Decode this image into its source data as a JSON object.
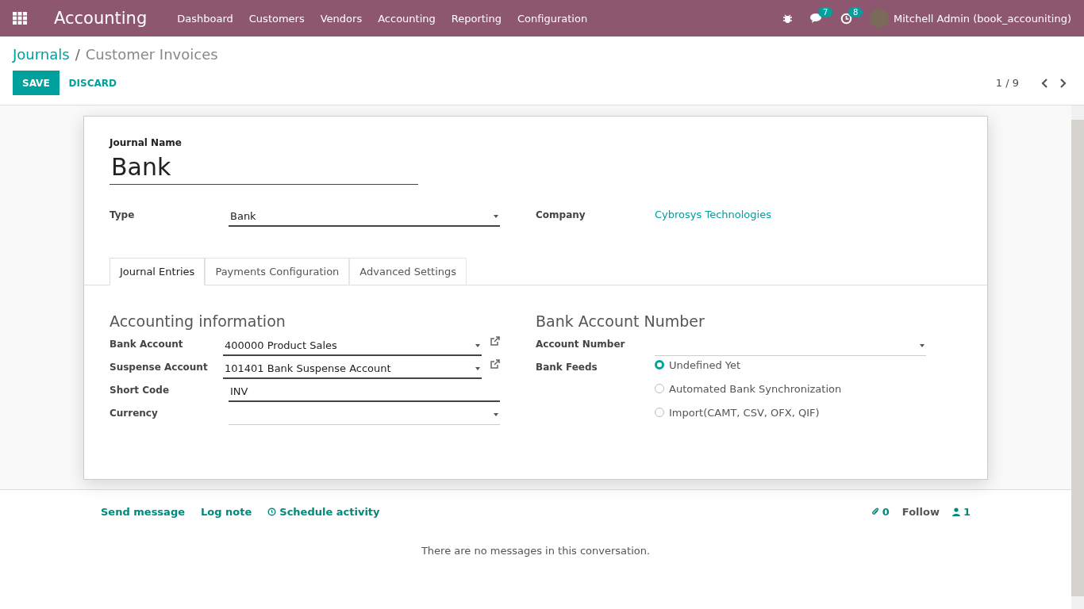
{
  "navbar": {
    "app_title": "Accounting",
    "menu": [
      "Dashboard",
      "Customers",
      "Vendors",
      "Accounting",
      "Reporting",
      "Configuration"
    ],
    "messages_count": "7",
    "activities_count": "8",
    "user": "Mitchell Admin (book_accouniting)"
  },
  "control_panel": {
    "breadcrumb": [
      "Journals",
      "Customer Invoices"
    ],
    "breadcrumb_separator": "/",
    "buttons": [
      "SAVE",
      "DISCARD"
    ],
    "pager": "1 / 9"
  },
  "form": {
    "name_label": "Journal Name",
    "name": "Bank",
    "header_fields": [
      {
        "label": "Type",
        "value": "Bank",
        "kind": "select"
      },
      {
        "label": "Company",
        "value": "Cybrosys Technologies",
        "kind": "link"
      }
    ],
    "tabs": [
      {
        "label": "Journal Entries",
        "selected": true
      },
      {
        "label": "Payments Configuration",
        "selected": false
      },
      {
        "label": "Advanced Settings",
        "selected": false
      }
    ],
    "left": {
      "title": "Accounting information",
      "fields": [
        {
          "label": "Bank Account",
          "value": "400000 Product Sales",
          "kind": "many2one"
        },
        {
          "label": "Suspense Account",
          "value": "101401 Bank Suspense Account",
          "kind": "many2one"
        },
        {
          "label": "Short Code",
          "value": "INV",
          "kind": "text"
        },
        {
          "label": "Currency",
          "kind": "select"
        }
      ]
    },
    "right": {
      "title": "Bank Account Number",
      "fields": [
        {
          "label": "Account Number",
          "kind": "select"
        }
      ],
      "feeds_label": "Bank Feeds",
      "feeds": [
        {
          "label": "Undefined Yet",
          "selected": true
        },
        {
          "label": "Automated Bank Synchronization",
          "selected": false
        },
        {
          "label": "Import(CAMT, CSV, OFX, QIF)",
          "selected": false
        }
      ]
    }
  },
  "chatter": {
    "actions": [
      "Send message",
      "Log note",
      "Schedule activity"
    ],
    "attachments": "0",
    "follow": "Follow",
    "followers": "1",
    "empty": "There are no messages in this conversation."
  }
}
